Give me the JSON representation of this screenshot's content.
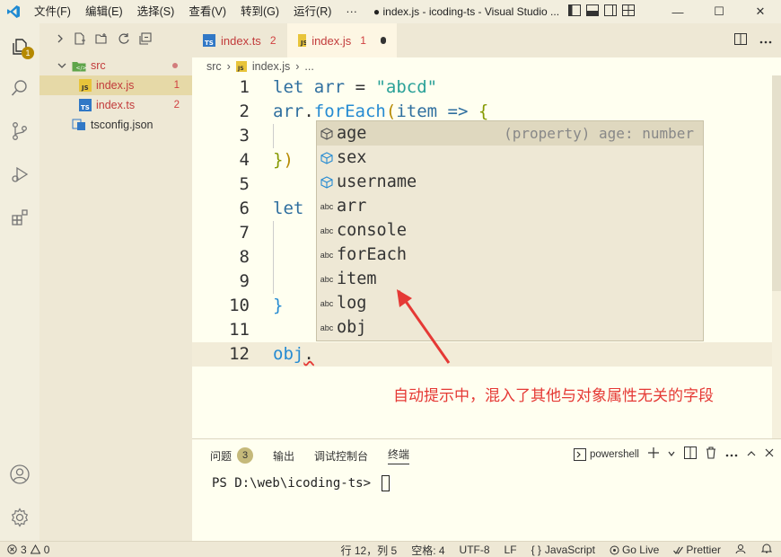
{
  "titlebar": {
    "menu": [
      "文件(F)",
      "编辑(E)",
      "选择(S)",
      "查看(V)",
      "转到(G)",
      "运行(R)",
      "···"
    ],
    "title": "● index.js - icoding-ts - Visual Studio ...",
    "controls": {
      "minimize": "—",
      "maximize": "☐",
      "close": "✕"
    }
  },
  "activitybar": {
    "explorer_badge": "1"
  },
  "sidebar": {
    "tree": [
      {
        "label": "src",
        "type": "folder"
      },
      {
        "label": "index.js",
        "type": "js",
        "count": "1"
      },
      {
        "label": "index.ts",
        "type": "ts",
        "count": "2"
      },
      {
        "label": "tsconfig.json",
        "type": "json"
      }
    ]
  },
  "tabs": [
    {
      "label": "index.ts",
      "count": "2"
    },
    {
      "label": "index.js",
      "count": "1"
    }
  ],
  "breadcrumb": {
    "folder": "src",
    "file": "index.js",
    "more": "..."
  },
  "editor": {
    "line_numbers": [
      "1",
      "2",
      "3",
      "4",
      "5",
      "6",
      "7",
      "8",
      "9",
      "10",
      "11",
      "12"
    ]
  },
  "suggest": {
    "items": [
      {
        "label": "age",
        "kind": "property",
        "detail": "(property) age: number"
      },
      {
        "label": "sex",
        "kind": "property"
      },
      {
        "label": "username",
        "kind": "property"
      },
      {
        "label": "arr",
        "kind": "abc"
      },
      {
        "label": "console",
        "kind": "abc"
      },
      {
        "label": "forEach",
        "kind": "abc"
      },
      {
        "label": "item",
        "kind": "abc"
      },
      {
        "label": "log",
        "kind": "abc"
      },
      {
        "label": "obj",
        "kind": "abc"
      }
    ],
    "abc_label": "abc"
  },
  "annotation": "自动提示中，混入了其他与对象属性无关的字段",
  "panel": {
    "tabs": [
      "问题",
      "输出",
      "调试控制台",
      "终端"
    ],
    "problems_badge": "3",
    "shell": "powershell",
    "prompt": "PS D:\\web\\icoding-ts> "
  },
  "statusbar": {
    "errors": "3",
    "warnings": "0",
    "position": "行 12，列 5",
    "spaces": "空格: 4",
    "encoding": "UTF-8",
    "eol": "LF",
    "language": "JavaScript",
    "golive": "Go Live",
    "prettier": "Prettier"
  },
  "colors": {
    "accent": "#b58900",
    "annotation": "#e53935"
  }
}
